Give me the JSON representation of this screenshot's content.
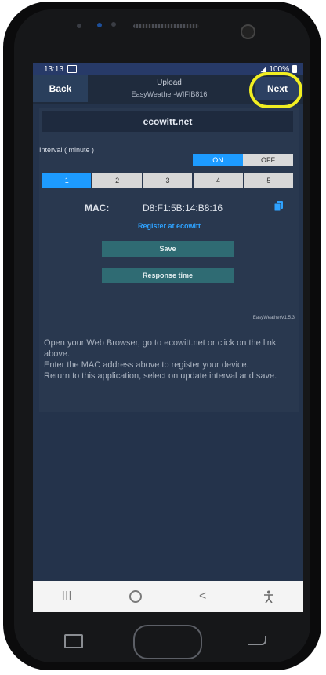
{
  "statusbar": {
    "time": "13:13",
    "battery": "100%"
  },
  "appbar": {
    "back_label": "Back",
    "title": "Upload",
    "subtitle": "EasyWeather-WIFIB816",
    "next_label": "Next"
  },
  "content": {
    "site": "ecowitt.net",
    "interval_label": "Interval ( minute )",
    "toggle": {
      "on": "ON",
      "off": "OFF",
      "selected": "ON"
    },
    "intervals": [
      "1",
      "2",
      "3",
      "4",
      "5"
    ],
    "selected_interval": "1",
    "mac_label": "MAC:",
    "mac_value": "D8:F1:5B:14:B8:16",
    "register_link": "Register at ecowitt",
    "save_label": "Save",
    "response_label": "Response time",
    "version": "EasyWeatherV1.5.3",
    "instructions": "Open your Web Browser, go to ecowitt.net or click on the link above.\nEnter the MAC address above to register your device.\nReturn to this application, select on update interval and save."
  },
  "navbar": {
    "recent": "III",
    "home": "O",
    "back": "<",
    "accessibility": "accessibility-icon"
  },
  "colors": {
    "accent": "#1d9bff",
    "button_green": "#2f6b73",
    "highlight": "#f1ee21"
  }
}
